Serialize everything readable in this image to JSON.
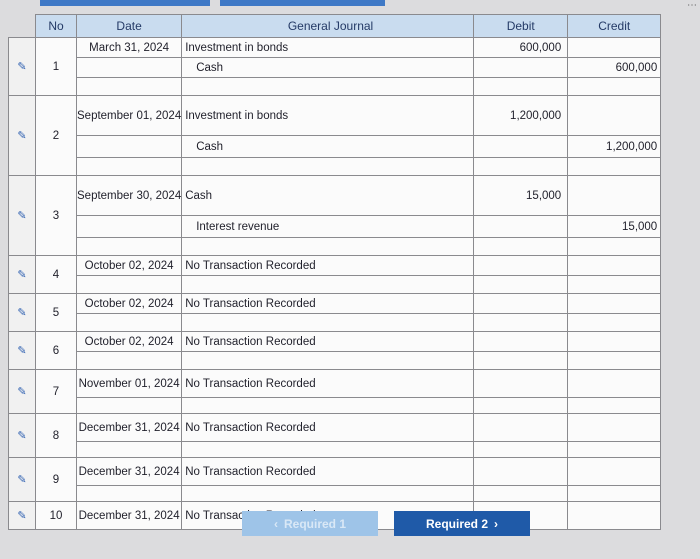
{
  "headers": {
    "no": "No",
    "date": "Date",
    "general_journal": "General Journal",
    "debit": "Debit",
    "credit": "Credit"
  },
  "rows": [
    {
      "no": "1",
      "date": "March 31, 2024",
      "lines": [
        {
          "account": "Investment in bonds",
          "debit": "600,000",
          "credit": ""
        },
        {
          "account": "Cash",
          "debit": "",
          "credit": "600,000"
        }
      ]
    },
    {
      "no": "2",
      "date": "September 01, 2024",
      "lines": [
        {
          "account": "Investment in bonds",
          "debit": "1,200,000",
          "credit": ""
        },
        {
          "account": "Cash",
          "debit": "",
          "credit": "1,200,000"
        }
      ]
    },
    {
      "no": "3",
      "date": "September 30, 2024",
      "lines": [
        {
          "account": "Cash",
          "debit": "15,000",
          "credit": ""
        },
        {
          "account": "Interest revenue",
          "debit": "",
          "credit": "15,000"
        }
      ]
    },
    {
      "no": "4",
      "date": "October 02, 2024",
      "lines": [
        {
          "account": "No Transaction Recorded",
          "debit": "",
          "credit": ""
        }
      ]
    },
    {
      "no": "5",
      "date": "October 02, 2024",
      "lines": [
        {
          "account": "No Transaction Recorded",
          "debit": "",
          "credit": ""
        }
      ]
    },
    {
      "no": "6",
      "date": "October 02, 2024",
      "lines": [
        {
          "account": "No Transaction Recorded",
          "debit": "",
          "credit": ""
        }
      ]
    },
    {
      "no": "7",
      "date": "November 01, 2024",
      "lines": [
        {
          "account": "No Transaction Recorded",
          "debit": "",
          "credit": ""
        }
      ]
    },
    {
      "no": "8",
      "date": "December 31, 2024",
      "lines": [
        {
          "account": "No Transaction Recorded",
          "debit": "",
          "credit": ""
        }
      ]
    },
    {
      "no": "9",
      "date": "December 31, 2024",
      "lines": [
        {
          "account": "No Transaction Recorded",
          "debit": "",
          "credit": ""
        }
      ]
    },
    {
      "no": "10",
      "date": "December 31, 2024",
      "lines": [
        {
          "account": "No Transaction Recorded",
          "debit": "",
          "credit": ""
        }
      ]
    }
  ],
  "nav": {
    "prev_label": "Required 1",
    "next_label": "Required 2",
    "prev_icon": "chevron-left-icon",
    "next_icon": "chevron-right-icon"
  },
  "icons": {
    "edit": "pencil-icon"
  },
  "colors": {
    "header_bg": "#c9dcef",
    "accent": "#1f5aa8",
    "disabled": "#9ec4e8"
  }
}
